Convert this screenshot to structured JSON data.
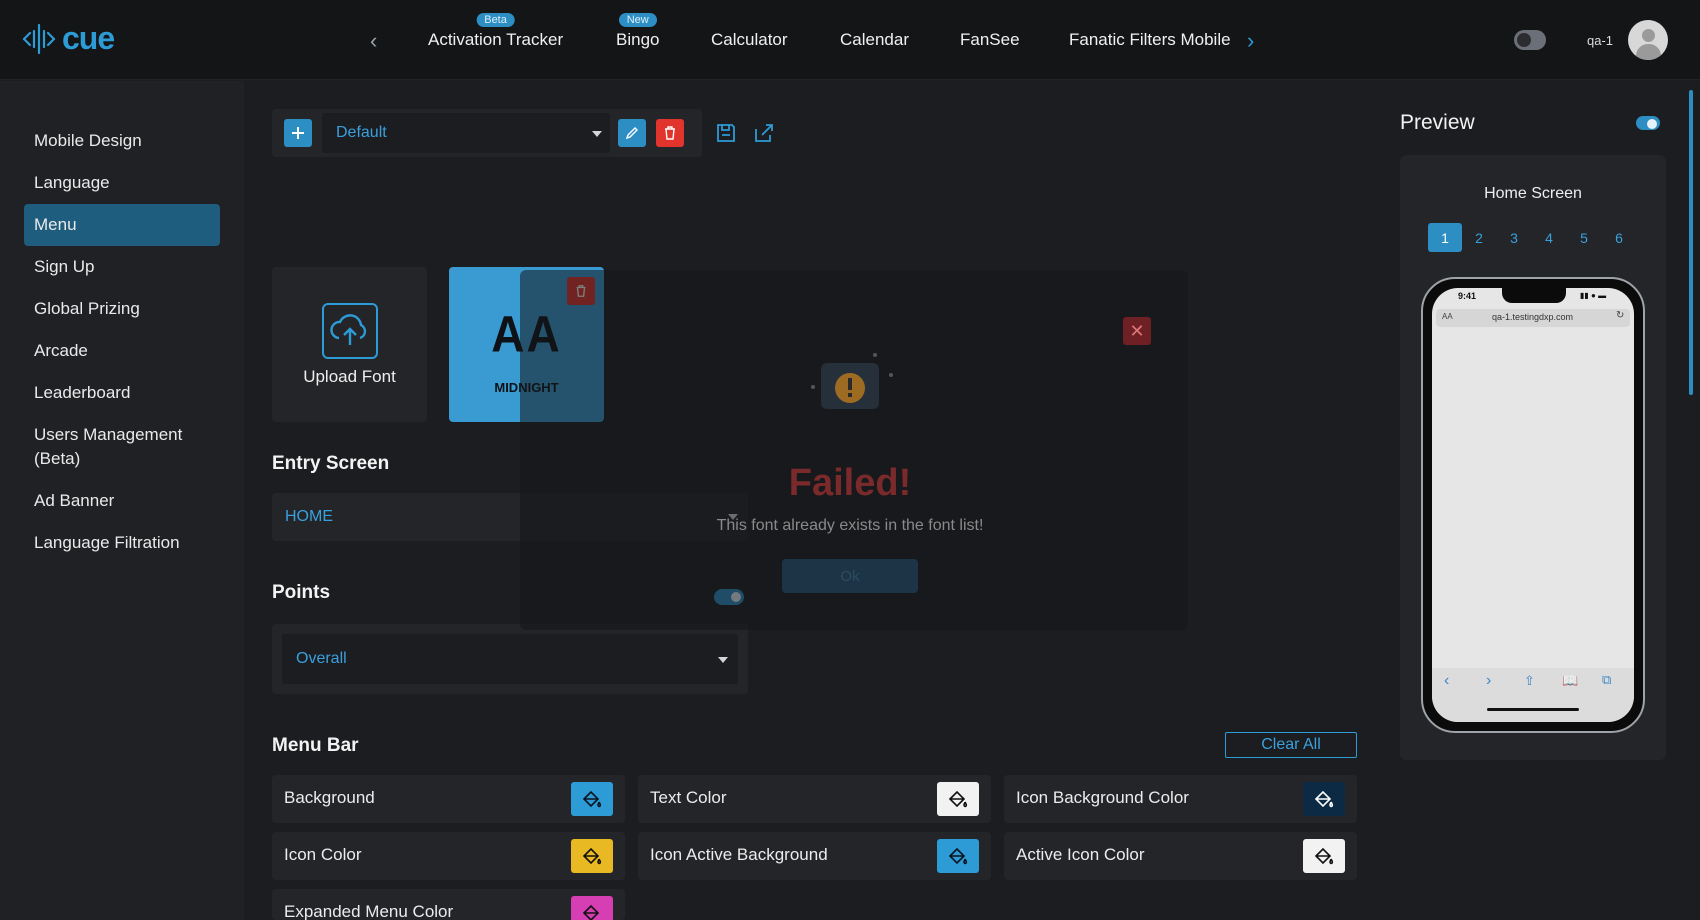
{
  "brand": {
    "name": "cue",
    "accent": "#2d9bd6"
  },
  "apps": {
    "tabs": [
      {
        "label": "Activation Tracker",
        "badge": "Beta"
      },
      {
        "label": "Bingo",
        "badge": "New"
      },
      {
        "label": "Calculator"
      },
      {
        "label": "Calendar"
      },
      {
        "label": "FanSee"
      },
      {
        "label": "Fanatic Filters Mobile"
      }
    ]
  },
  "user": {
    "name": "qa-1"
  },
  "sidebar": {
    "items": [
      {
        "label": "Mobile Design"
      },
      {
        "label": "Language"
      },
      {
        "label": "Menu",
        "active": true
      },
      {
        "label": "Sign Up"
      },
      {
        "label": "Global Prizing"
      },
      {
        "label": "Arcade"
      },
      {
        "label": "Leaderboard"
      },
      {
        "label": "Users Management (Beta)"
      },
      {
        "label": "Ad Banner"
      },
      {
        "label": "Language Filtration"
      }
    ]
  },
  "theme_select": {
    "value": "Default"
  },
  "fonts": {
    "upload_label": "Upload Font",
    "tile_glyph": "AA",
    "tile_name": "MIDNIGHT"
  },
  "entry_screen": {
    "title": "Entry Screen",
    "value": "HOME"
  },
  "points": {
    "title": "Points",
    "value": "Overall",
    "enabled": true
  },
  "menu_bar": {
    "title": "Menu Bar",
    "clear_all": "Clear All",
    "rows": [
      {
        "label": "Background",
        "color": "#2d9bd6"
      },
      {
        "label": "Text Color",
        "color": "#f2f2f2"
      },
      {
        "label": "Icon Background Color",
        "color": "#0d2a45"
      },
      {
        "label": "Icon Color",
        "color": "#e8b923"
      },
      {
        "label": "Icon Active Background",
        "color": "#2d9bd6"
      },
      {
        "label": "Active Icon Color",
        "color": "#f2f2f2"
      },
      {
        "label": "Expanded Menu Color",
        "color": "#d63fb3"
      }
    ]
  },
  "modal": {
    "title": "Failed!",
    "message": "This font already exists in the font list!",
    "ok": "Ok"
  },
  "preview": {
    "title": "Preview",
    "screen": "Home Screen",
    "pages": [
      "1",
      "2",
      "3",
      "4",
      "5",
      "6"
    ],
    "active_page": "1",
    "phone_time": "9:41",
    "phone_url": "qa-1.testingdxp.com",
    "phone_aa": "AA"
  }
}
